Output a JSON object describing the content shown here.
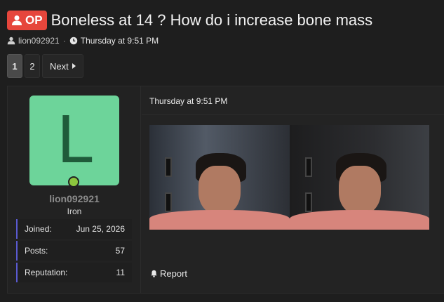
{
  "thread": {
    "badge": "OP",
    "title": "Boneless at 14 ? How do i increase bone mass",
    "author": "lion092921",
    "separator": "·",
    "date": "Thursday at 9:51 PM"
  },
  "pagination": {
    "pages": [
      "1",
      "2"
    ],
    "current": "1",
    "next_label": "Next"
  },
  "post": {
    "date": "Thursday at 9:51 PM",
    "report_label": "Report",
    "user": {
      "avatar_letter": "L",
      "avatar_color": "#6dd49a",
      "username": "lion092921",
      "title": "Iron",
      "stats": [
        {
          "label": "Joined:",
          "value": "Jun 25, 2026"
        },
        {
          "label": "Posts:",
          "value": "57"
        },
        {
          "label": "Reputation:",
          "value": "11"
        }
      ]
    }
  },
  "colors": {
    "background": "#1e1e1e",
    "op_badge": "#e6463c",
    "online": "#8cc63e",
    "stat_accent": "#5a5ad0"
  },
  "icons": {
    "badge": "user-icon",
    "author": "user-icon",
    "date": "clock-icon",
    "next": "caret-right-icon",
    "report": "bell-icon"
  }
}
